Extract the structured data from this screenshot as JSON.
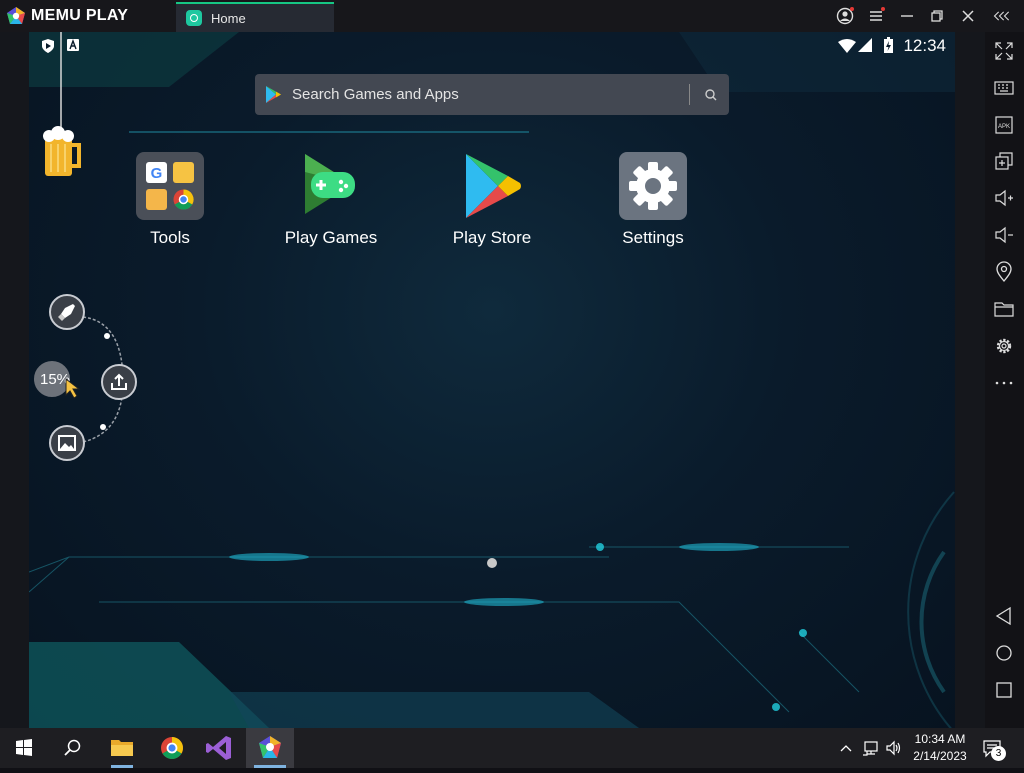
{
  "window": {
    "brand": "MEMU PLAY",
    "tab_label": "Home",
    "accent": "#16c784"
  },
  "titlebar_icons": [
    "user-account-icon",
    "menu-icon",
    "minimize-icon",
    "restore-icon",
    "close-icon",
    "collapse-sidebar-icon"
  ],
  "android": {
    "status_time": "12:34",
    "search": {
      "placeholder": "Search Games and Apps"
    },
    "apps": [
      {
        "label": "Tools",
        "icon": "tools-folder-icon"
      },
      {
        "label": "Play Games",
        "icon": "play-games-icon"
      },
      {
        "label": "Play Store",
        "icon": "play-store-icon"
      },
      {
        "label": "Settings",
        "icon": "settings-gear-icon"
      }
    ],
    "floating_tool": {
      "progress_text": "15%"
    }
  },
  "sidebar_icons": [
    "fullscreen-icon",
    "keyboard-icon",
    "apk-install-icon",
    "multi-window-icon",
    "volume-up-icon",
    "volume-down-icon",
    "location-icon",
    "folder-icon",
    "settings-icon",
    "more-icon",
    "back-icon",
    "home-icon",
    "recents-icon"
  ],
  "taskbar": {
    "items": [
      "windows-start-icon",
      "search-icon",
      "file-explorer-icon",
      "chrome-icon",
      "visual-studio-icon",
      "memu-icon"
    ],
    "clock_time": "10:34 AM",
    "clock_date": "2/14/2023",
    "notification_count": "3"
  }
}
